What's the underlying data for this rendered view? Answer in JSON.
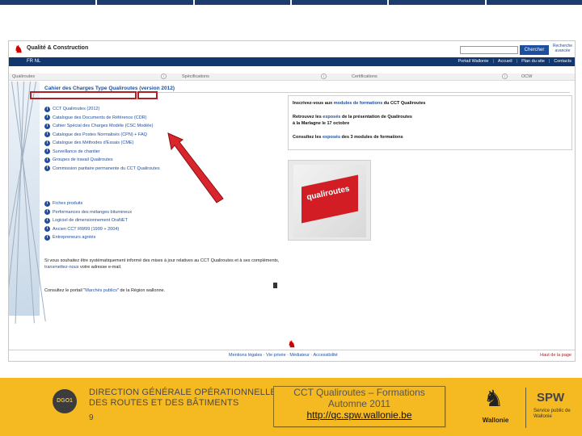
{
  "strip_colors": [
    "#1d3c6e",
    "#1d3c6e",
    "#1d3c6e",
    "#1d3c6e",
    "#1d3c6e",
    "#1d3c6e"
  ],
  "site": {
    "title": "Qualité & Construction",
    "search_button": "Chercher",
    "advanced_search": "Recherche avancée",
    "lang": "FR   NL",
    "topnav": [
      "Portail Wallonie",
      "Accueil",
      "Plan du site",
      "Contacts"
    ]
  },
  "sections": [
    "Qualiroutes",
    "Spécifications",
    "Certifications",
    "OCW"
  ],
  "content": {
    "title": "Cahier des Charges Type Qualiroutes (version 2012)",
    "links_group1": [
      "CCT Qualiroutes (2012)",
      "Catalogue des Documents de Référence (CDR)",
      "Cahier Spécial des Charges Modèle (CSC Modèle)",
      "Catalogue des Postes Normalisés (CPN) + FAQ",
      "Catalogue des Méthodes d'Essais (CME)",
      "Surveillance de chantier",
      "Groupes de travail Qualiroutes",
      "Commission paritaire permanente du CCT Qualiroutes"
    ],
    "links_group2": [
      "Fiches produits",
      "Performances des mélanges bitumineux",
      "Logiciel de dimensionnement OraNET",
      "Ancien CCT RW99 (1999 + 2004)",
      "Entrepreneurs agréés"
    ],
    "subscribe_text": "Si vous souhaitez être systématiquement informé des mises à jour relatives au CCT Qualiroutes et à ses compléments,",
    "subscribe_link": "transmettez-nous",
    "subscribe_tail": " votre adresse e-mail.",
    "portal_prefix": "Consultez le portail \"",
    "portal_link": "Marchés publics",
    "portal_suffix": "\" de la Région wallonne."
  },
  "news": {
    "line1_a": "Inscrivez-vous aux ",
    "line1_link": "modules de formations",
    "line1_b": " du CCT Qualiroutes",
    "line2_a": "Retrouvez les ",
    "line2_link": "exposés",
    "line2_b": " de la présentation de Qualiroutes",
    "line3": "à la Marlagne le 17 octobre",
    "line4_a": "Consultez les ",
    "line4_link": "exposés",
    "line4_b": " des 3 modules de formations"
  },
  "cover": {
    "title": "qualiroutes"
  },
  "footer": {
    "links": "Mentions légales · Vie privée · Médiateur · Accessibilité",
    "page_top": "Haut de la page"
  },
  "banner": {
    "dgo_logo": "DGO1",
    "dgo_line1": "DIRECTION GÉNÉRALE OPÉRATIONNELLE",
    "dgo_line2": "DES ROUTES ET DES BÂTIMENTS",
    "slide_number": "9",
    "info_line1": "CCT Qualiroutes – Formations",
    "info_line2": "Automne 2011",
    "info_url": "http://qc.spw.wallonie.be",
    "wallonie": "Wallonie",
    "spw_mark": "SPW",
    "spw_text": "Service public de Wallonie"
  }
}
